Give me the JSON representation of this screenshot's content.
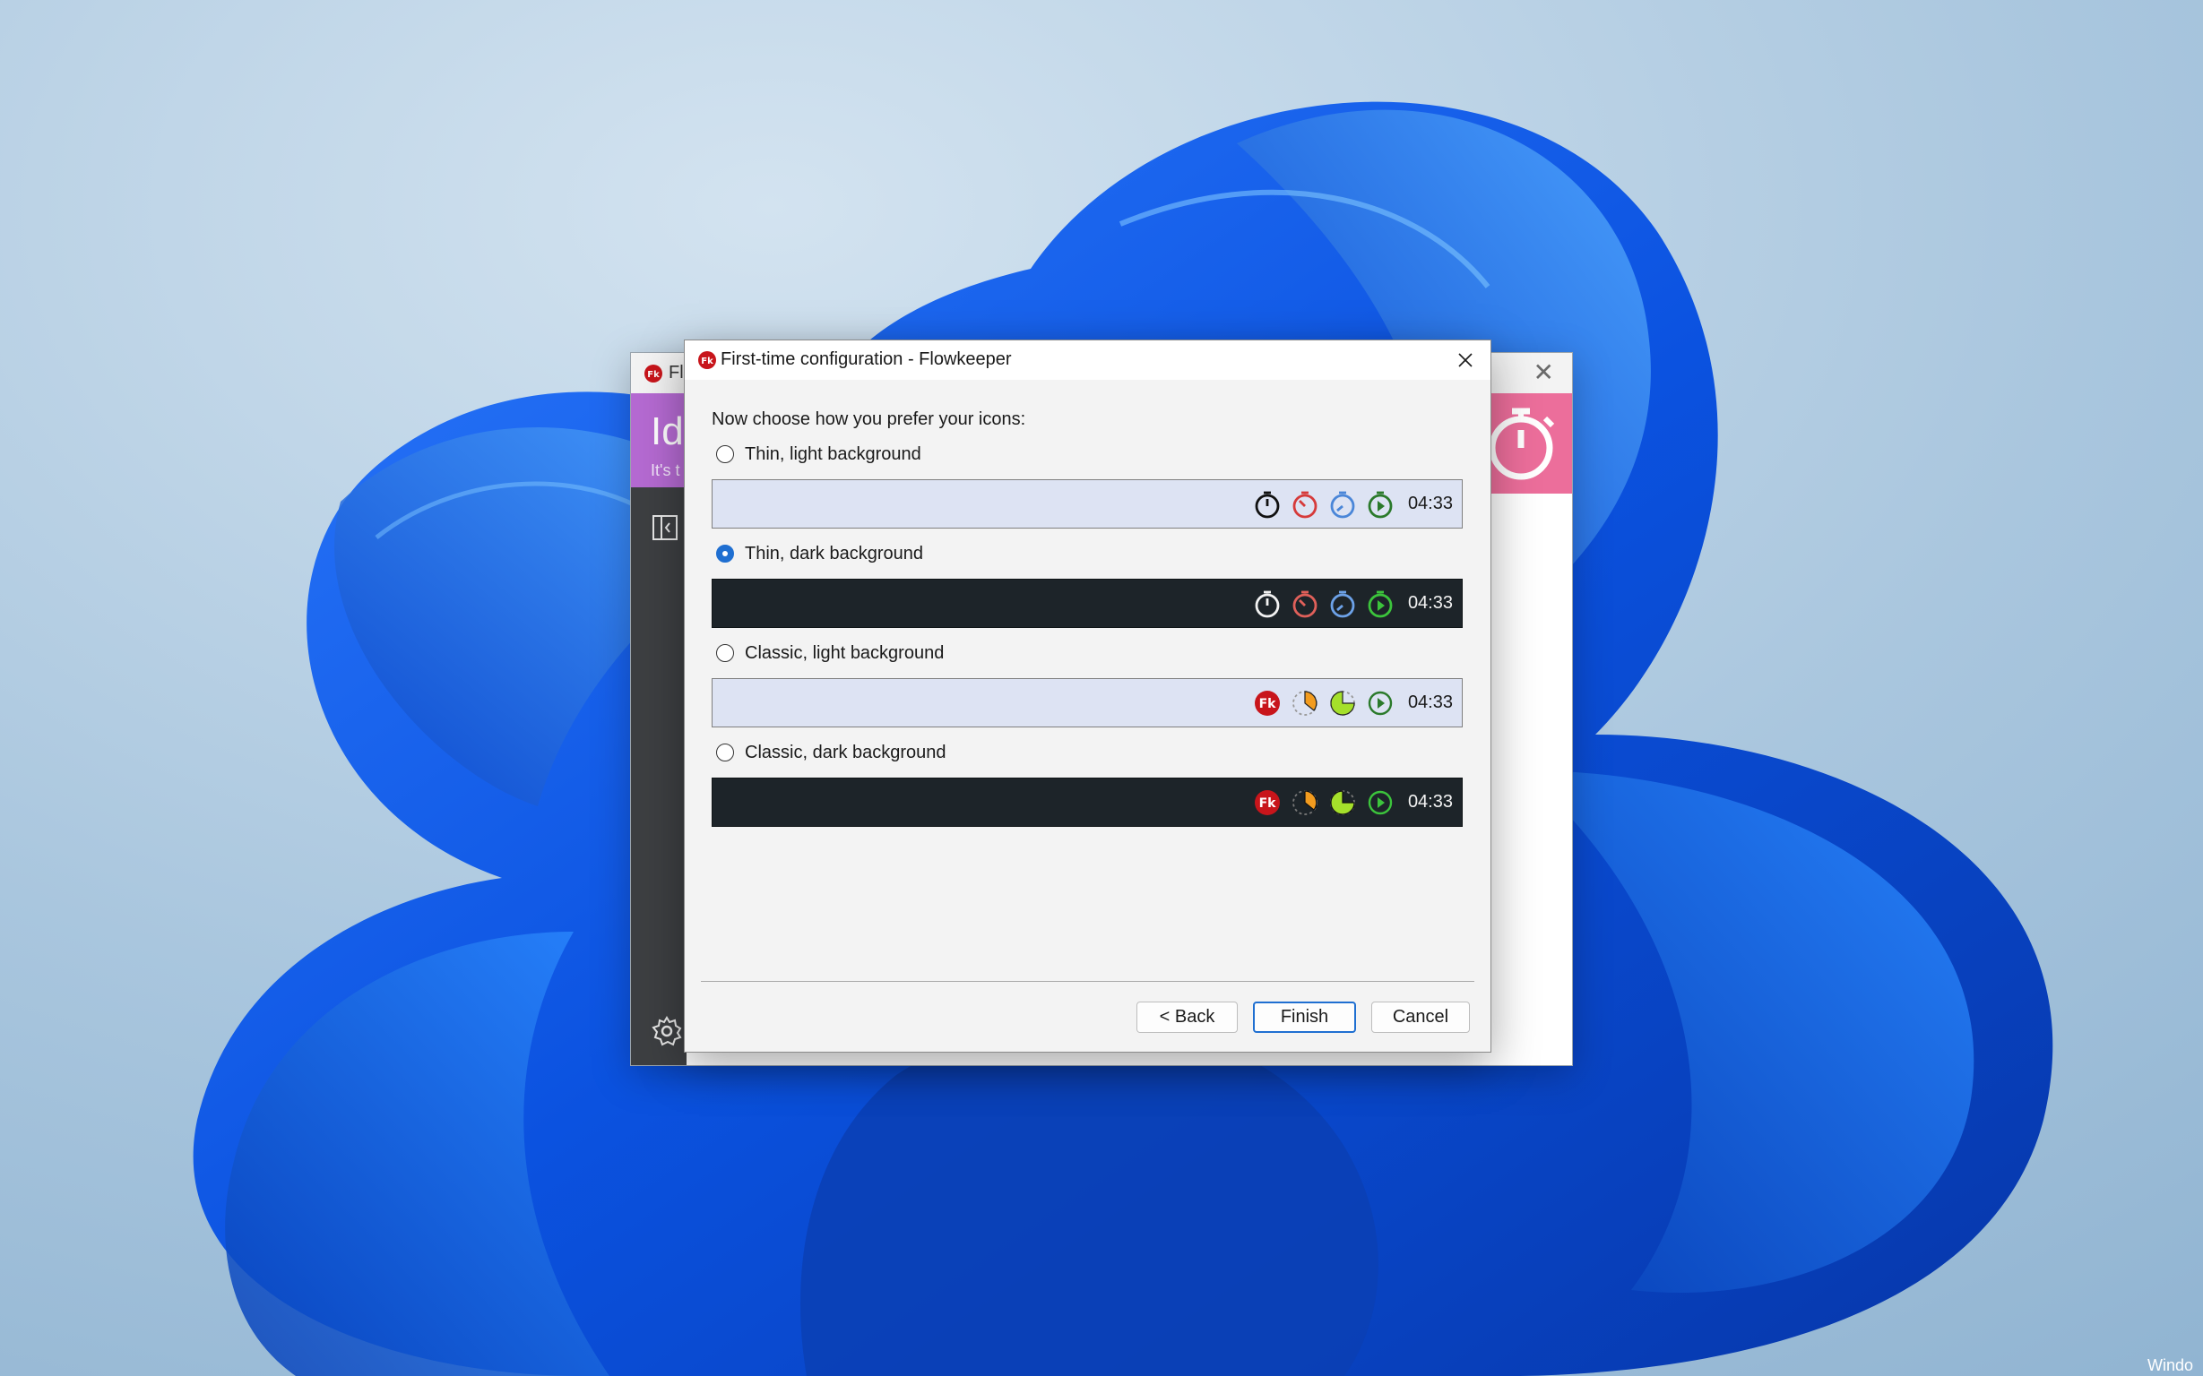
{
  "background_window": {
    "title": "Flo",
    "header_big": "Id",
    "header_sub": "It's t"
  },
  "dialog": {
    "title": "First-time configuration - Flowkeeper",
    "prompt": "Now choose how you prefer your icons:",
    "options": [
      {
        "label": "Thin, light background",
        "selected": false,
        "theme": "light",
        "style": "thin",
        "time": "04:33"
      },
      {
        "label": "Thin, dark background",
        "selected": true,
        "theme": "dark",
        "style": "thin",
        "time": "04:33"
      },
      {
        "label": "Classic, light background",
        "selected": false,
        "theme": "light",
        "style": "classic",
        "time": "04:33"
      },
      {
        "label": "Classic, dark background",
        "selected": false,
        "theme": "dark",
        "style": "classic",
        "time": "04:33"
      }
    ],
    "buttons": {
      "back": "< Back",
      "finish": "Finish",
      "cancel": "Cancel"
    }
  },
  "app_icon_text": "Fk",
  "corner_text": "Windo",
  "colors": {
    "accent": "#1f6fd1",
    "preview_light": "#dde3f3",
    "preview_dark": "#1d2429",
    "header_purple": "#b56ad2",
    "header_pink": "#ec6e9b"
  },
  "icons": {
    "thin": [
      "stopwatch-icon",
      "red-timer-icon",
      "blue-timer-icon",
      "green-play-icon"
    ],
    "classic": [
      "flowkeeper-logo-icon",
      "orange-pie-icon",
      "lime-pie-icon",
      "green-play-icon"
    ]
  }
}
